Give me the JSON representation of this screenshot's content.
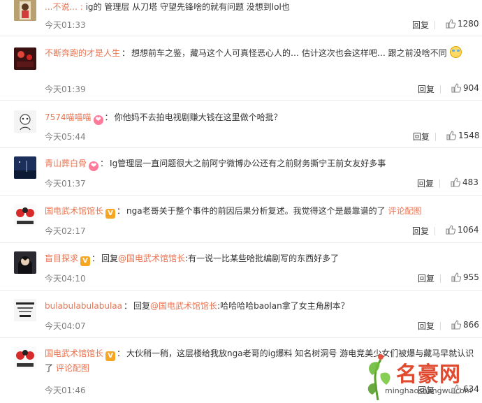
{
  "comments": [
    {
      "user": "...不说... :",
      "badge": "",
      "avatar": "portrait-photo-icon",
      "text_before": "ig的 管理层 从刀塔 守望先锋啥的就有问题 没想到lol也",
      "mention": "",
      "text_after": "",
      "pic": "",
      "emoji": false,
      "time": "今天01:33",
      "reply": "回复",
      "likes": "1280"
    },
    {
      "user": "不断奔跑的才是人生",
      "badge": "",
      "avatar": "red-lights-photo-icon",
      "text_before": "想想前车之鉴，藏马这个人可真怪恶心人的… 估计这次也会这样吧… 跟之前没啥不同",
      "mention": "",
      "text_after": "",
      "pic": "",
      "emoji": true,
      "time": "今天01:39",
      "reply": "回复",
      "likes": "904"
    },
    {
      "user": "7574喵喵喵",
      "badge": "fan",
      "avatar": "cartoon-avatar-icon",
      "text_before": "你他妈不去拍电视剧赚大钱在这里做个哈批？",
      "mention": "",
      "text_after": "",
      "pic": "",
      "emoji": false,
      "time": "今天05:44",
      "reply": "回复",
      "likes": "1548"
    },
    {
      "user": "青山葬白骨",
      "badge": "fan",
      "avatar": "night-sky-photo-icon",
      "text_before": "Ig管理层一直问题很大之前阿宁微博办公还有之前财务撕宁王前女友好多事",
      "mention": "",
      "text_after": "",
      "pic": "",
      "emoji": false,
      "time": "今天01:37",
      "reply": "回复",
      "likes": "483"
    },
    {
      "user": "国电武术馆馆长",
      "badge": "v",
      "avatar": "boxer-avatar-icon",
      "text_before": "nga老哥关于整个事件的前因后果分析复述。我觉得这个是最靠谱的了",
      "mention": "",
      "text_after": "",
      "pic": "评论配图",
      "emoji": false,
      "time": "今天02:17",
      "reply": "回复",
      "likes": "1064"
    },
    {
      "user": "盲目探求",
      "badge": "v",
      "avatar": "anime-character-icon",
      "text_before": "回复",
      "mention": "@国电武术馆馆长",
      "text_after": ":有一说一比某些哈批编剧写的东西好多了",
      "pic": "",
      "emoji": false,
      "time": "今天04:10",
      "reply": "回复",
      "likes": "955"
    },
    {
      "user": "bulabulabulabulaa",
      "badge": "",
      "avatar": "text-card-avatar-icon",
      "text_before": "回复",
      "mention": "@国电武术馆馆长",
      "text_after": ":哈哈哈哈baolan拿了女主角剧本？",
      "pic": "",
      "emoji": false,
      "time": "今天04:07",
      "reply": "回复",
      "likes": "866"
    },
    {
      "user": "国电武术馆馆长",
      "badge": "v",
      "avatar": "boxer-avatar-icon",
      "text_before": "大伙稍一稍，这层楼给我放nga老哥的ig爆料 知名树洞号 游电竞美少女们被爆与藏马早就认识了",
      "mention": "",
      "text_after": "",
      "pic": "评论配图",
      "emoji": false,
      "time": "今天01:46",
      "reply": "回复",
      "likes": "634"
    }
  ],
  "watermark": {
    "main": "名豪网",
    "sub": "minghaoshangwu.com"
  },
  "colors": {
    "accent": "#eb7350",
    "time": "#808080",
    "vip": "#f6a623"
  }
}
